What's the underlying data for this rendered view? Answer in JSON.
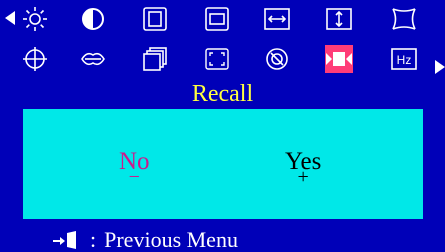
{
  "menu": {
    "left_arrow": "left-arrow-icon",
    "right_arrow": "right-arrow-icon",
    "row1": [
      "brightness-icon",
      "contrast-icon",
      "h-size-icon",
      "v-size-icon",
      "h-position-icon",
      "v-position-icon",
      "pincushion-icon"
    ],
    "row2": [
      "rotation-icon",
      "trapezoid-icon",
      "multi-window-icon",
      "zoom-icon",
      "degauss-icon",
      "recall-icon",
      "frequency-icon"
    ],
    "selected": "recall-icon",
    "frequency_icon_text": "Hz"
  },
  "title": "Recall",
  "dialog": {
    "no_label": "No",
    "no_symbol": "−",
    "yes_label": "Yes",
    "yes_symbol": "+"
  },
  "footer": {
    "colon": ":",
    "text": "Previous Menu",
    "icon": "exit-door-icon"
  },
  "colors": {
    "background": "#0000b8",
    "panel": "#00e8e8",
    "title": "#ffff40",
    "no_text": "#cc1a8c",
    "selected_icon_bg": "#ff3c78"
  }
}
